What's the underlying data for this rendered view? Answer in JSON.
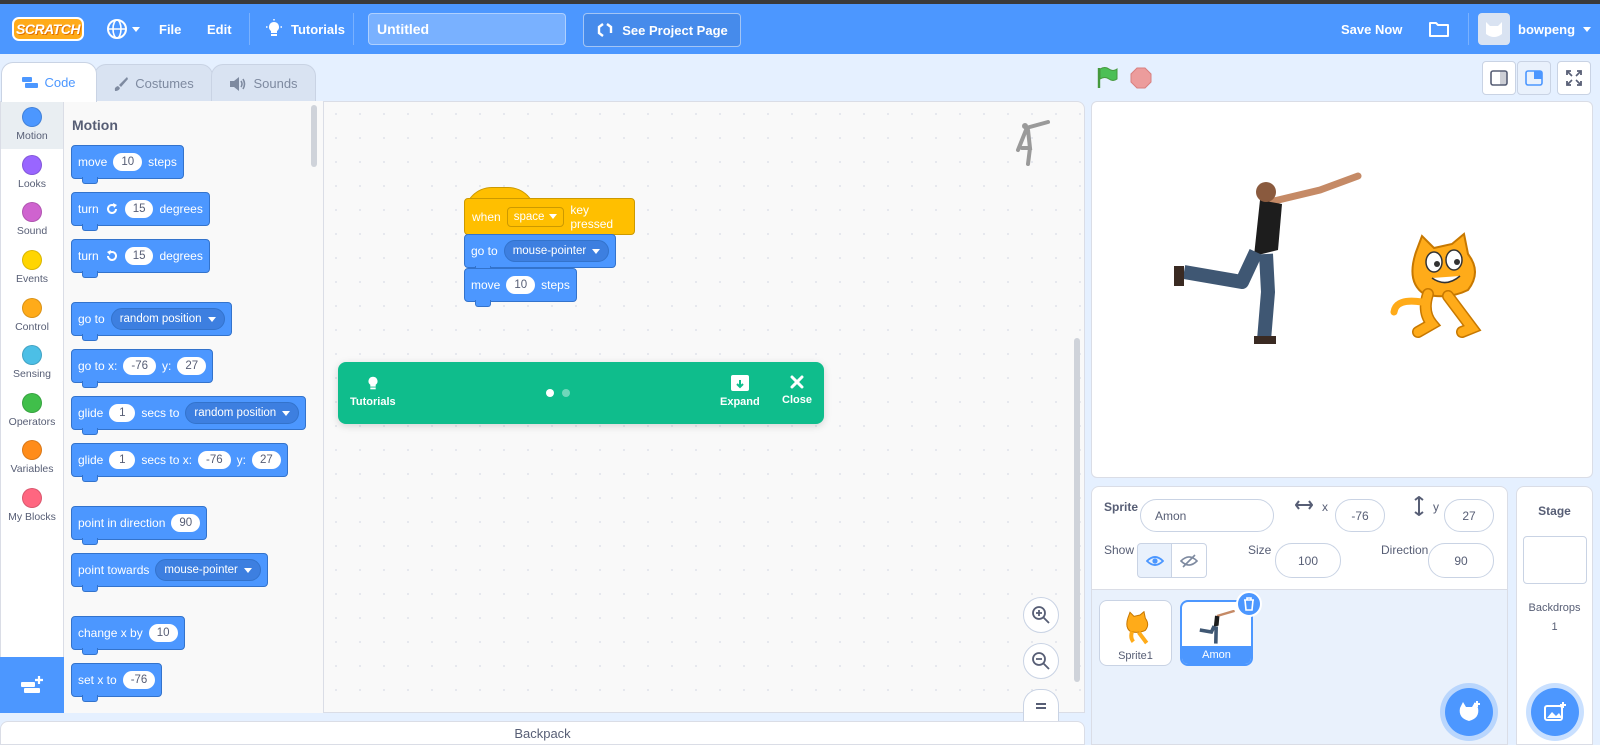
{
  "menubar": {
    "logo": "SCRATCH",
    "file": "File",
    "edit": "Edit",
    "tutorials": "Tutorials",
    "project_title": "Untitled",
    "see_project_page": "See Project Page",
    "save_now": "Save Now",
    "username": "bowpeng"
  },
  "tabs": {
    "code": "Code",
    "costumes": "Costumes",
    "sounds": "Sounds"
  },
  "categories": [
    {
      "label": "Motion",
      "color": "#4c97ff"
    },
    {
      "label": "Looks",
      "color": "#9966ff"
    },
    {
      "label": "Sound",
      "color": "#cf63cf"
    },
    {
      "label": "Events",
      "color": "#ffd500"
    },
    {
      "label": "Control",
      "color": "#ffab19"
    },
    {
      "label": "Sensing",
      "color": "#4cbfe6"
    },
    {
      "label": "Operators",
      "color": "#40bf4a"
    },
    {
      "label": "Variables",
      "color": "#ff8c1a"
    },
    {
      "label": "My Blocks",
      "color": "#ff6680"
    }
  ],
  "palette": {
    "heading": "Motion",
    "move": {
      "a": "move",
      "v": "10",
      "b": "steps"
    },
    "turn_right": {
      "a": "turn",
      "v": "15",
      "b": "degrees"
    },
    "turn_left": {
      "a": "turn",
      "v": "15",
      "b": "degrees"
    },
    "goto": {
      "a": "go to",
      "d": "random position"
    },
    "gotoxy": {
      "a": "go to x:",
      "x": "-76",
      "b": "y:",
      "y": "27"
    },
    "glide_to": {
      "a": "glide",
      "v": "1",
      "b": "secs to",
      "d": "random position"
    },
    "glide_xy": {
      "a": "glide",
      "v": "1",
      "b": "secs to x:",
      "x": "-76",
      "c": "y:",
      "y": "27"
    },
    "point_dir": {
      "a": "point in direction",
      "v": "90"
    },
    "point_towards": {
      "a": "point towards",
      "d": "mouse-pointer"
    },
    "change_x": {
      "a": "change x by",
      "v": "10"
    },
    "set_x": {
      "a": "set x to",
      "v": "-76"
    }
  },
  "script": {
    "when": "when",
    "key": "space",
    "pressed": "key pressed",
    "goto": "go to",
    "goto_target": "mouse-pointer",
    "move": "move",
    "move_val": "10",
    "steps": "steps"
  },
  "tutorial_bar": {
    "tutorials": "Tutorials",
    "expand": "Expand",
    "close": "Close"
  },
  "backpack": "Backpack",
  "sprite_info": {
    "sprite_label": "Sprite",
    "sprite_name": "Amon",
    "x_label": "x",
    "x_value": "-76",
    "y_label": "y",
    "y_value": "27",
    "show_label": "Show",
    "size_label": "Size",
    "size_value": "100",
    "direction_label": "Direction",
    "direction_value": "90"
  },
  "sprites": [
    {
      "name": "Sprite1"
    },
    {
      "name": "Amon"
    }
  ],
  "stage_pane": {
    "title": "Stage",
    "backdrops_label": "Backdrops",
    "backdrops_count": "1"
  }
}
